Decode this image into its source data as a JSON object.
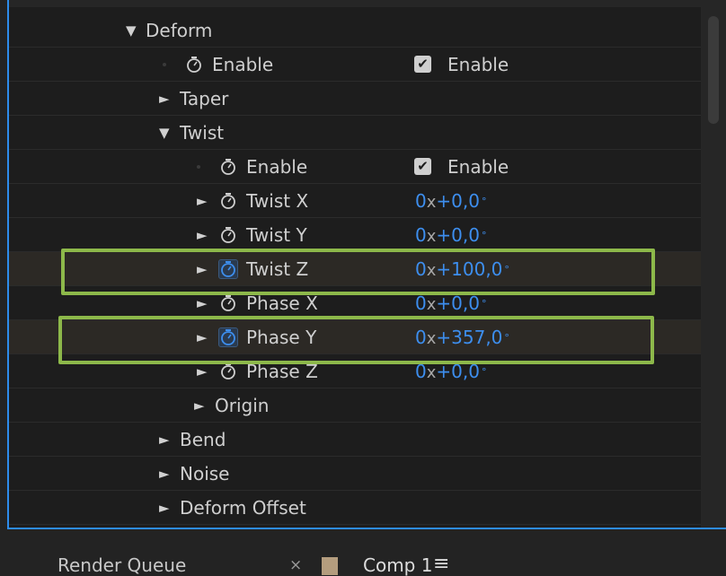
{
  "layers": {
    "deform": {
      "label": "Deform",
      "expanded": true
    },
    "deform_enable": {
      "label": "Enable",
      "checkbox_label": "Enable",
      "checked": true
    },
    "taper": {
      "label": "Taper"
    },
    "twist": {
      "label": "Twist",
      "expanded": true
    },
    "twist_enable": {
      "label": "Enable",
      "checkbox_label": "Enable",
      "checked": true
    },
    "twist_x": {
      "label": "Twist X",
      "rev": "0",
      "x": "x",
      "angle": "+0,0",
      "deg": "°"
    },
    "twist_y": {
      "label": "Twist Y",
      "rev": "0",
      "x": "x",
      "angle": "+0,0",
      "deg": "°"
    },
    "twist_z": {
      "label": "Twist Z",
      "rev": "0",
      "x": "x",
      "angle": "+100,0",
      "deg": "°",
      "stopwatch_active": true
    },
    "phase_x": {
      "label": "Phase X",
      "rev": "0",
      "x": "x",
      "angle": "+0,0",
      "deg": "°"
    },
    "phase_y": {
      "label": "Phase Y",
      "rev": "0",
      "x": "x",
      "angle": "+357,0",
      "deg": "°",
      "stopwatch_active": true
    },
    "phase_z": {
      "label": "Phase Z",
      "rev": "0",
      "x": "x",
      "angle": "+0,0",
      "deg": "°"
    },
    "origin": {
      "label": "Origin"
    },
    "bend": {
      "label": "Bend"
    },
    "noise": {
      "label": "Noise"
    },
    "deform_offset": {
      "label": "Deform Offset"
    }
  },
  "tabs": {
    "render_queue": "Render Queue",
    "close": "×",
    "comp": "Comp 1",
    "menu": "≡"
  },
  "colors": {
    "highlight_box": "#8db84a",
    "value_blue": "#3d8eee",
    "panel_border": "#2d8ceb",
    "comp_swatch": "#b49d7e"
  }
}
